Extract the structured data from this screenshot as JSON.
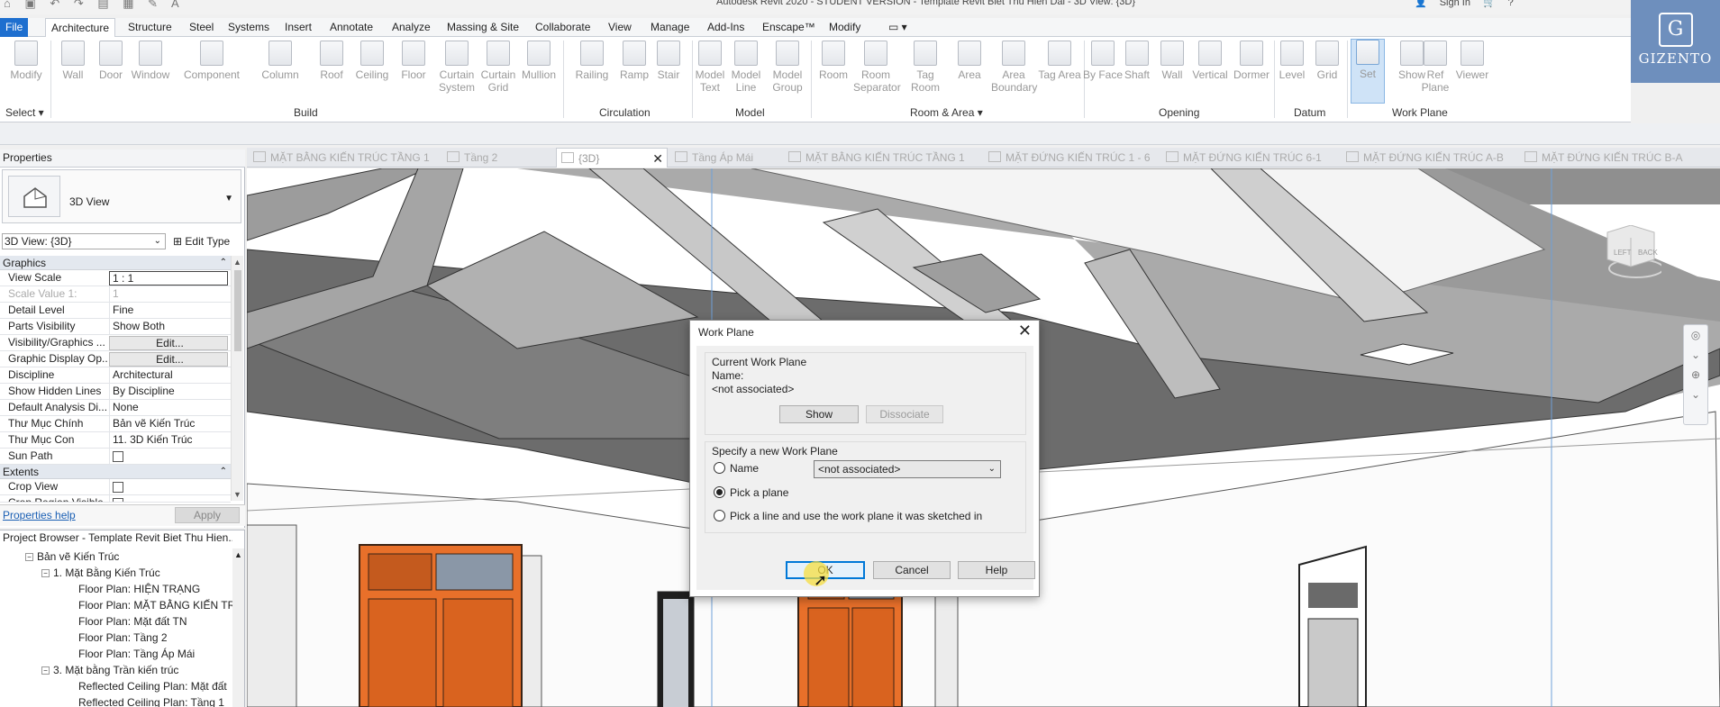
{
  "titlebar": {
    "qat_icons": "⌂ ▣ ↶ ↷ ▤ ▦ ✎ A",
    "title": "Autodesk Revit 2020 - STUDENT VERSION - Template Revit Biet Thu Hien Dai - 3D View: {3D}",
    "sign_in": "Sign In",
    "help": "?"
  },
  "ribbon_tabs": [
    {
      "label": "File"
    },
    {
      "label": "Architecture"
    },
    {
      "label": "Structure"
    },
    {
      "label": "Steel"
    },
    {
      "label": "Systems"
    },
    {
      "label": "Insert"
    },
    {
      "label": "Annotate"
    },
    {
      "label": "Analyze"
    },
    {
      "label": "Massing & Site"
    },
    {
      "label": "Collaborate"
    },
    {
      "label": "View"
    },
    {
      "label": "Manage"
    },
    {
      "label": "Add-Ins"
    },
    {
      "label": "Enscape™"
    },
    {
      "label": "Modify"
    }
  ],
  "ribbon": {
    "buttons": {
      "modify": "Modify",
      "wall": "Wall",
      "door": "Door",
      "window": "Window",
      "component": "Component",
      "column": "Column",
      "roof": "Roof",
      "ceiling": "Ceiling",
      "floor": "Floor",
      "curtain_system": "Curtain System",
      "curtain_grid": "Curtain Grid",
      "mullion": "Mullion",
      "railing": "Railing",
      "ramp": "Ramp",
      "stair": "Stair",
      "model_text": "Model Text",
      "model_line": "Model Line",
      "model_group": "Model Group",
      "room": "Room",
      "room_separator": "Room Separator",
      "tag_room": "Tag Room",
      "area": "Area",
      "area_boundary": "Area Boundary",
      "tag_area": "Tag Area",
      "by_face": "By Face",
      "shaft": "Shaft",
      "wall_open": "Wall",
      "vertical": "Vertical",
      "dormer": "Dormer",
      "level": "Level",
      "grid": "Grid",
      "set": "Set",
      "show": "Show",
      "ref_plane": "Ref Plane",
      "viewer": "Viewer"
    },
    "panels": {
      "select": "Select ▾",
      "build": "Build",
      "circulation": "Circulation",
      "model": "Model",
      "room_area": "Room & Area ▾",
      "opening": "Opening",
      "datum": "Datum",
      "work_plane": "Work Plane"
    }
  },
  "logo": {
    "mark": "G",
    "word": "GIZENTO"
  },
  "properties": {
    "title": "Properties",
    "type_name": "3D View",
    "instance_selector": "3D View: {3D}",
    "edit_type": "Edit Type",
    "categories": {
      "graphics": "Graphics",
      "extents": "Extents"
    },
    "rows": [
      {
        "name": "View Scale",
        "value": "1 : 1"
      },
      {
        "name": "Scale Value    1:",
        "value": "1"
      },
      {
        "name": "Detail Level",
        "value": "Fine"
      },
      {
        "name": "Parts Visibility",
        "value": "Show Both"
      },
      {
        "name": "Visibility/Graphics ...",
        "value": "Edit..."
      },
      {
        "name": "Graphic Display Op...",
        "value": "Edit..."
      },
      {
        "name": "Discipline",
        "value": "Architectural"
      },
      {
        "name": "Show Hidden Lines",
        "value": "By Discipline"
      },
      {
        "name": "Default Analysis Di...",
        "value": "None"
      },
      {
        "name": "Thư Mục Chính",
        "value": "Bản vẽ Kiến Trúc"
      },
      {
        "name": "Thư Mục Con",
        "value": "11. 3D Kiến Trúc"
      },
      {
        "name": "Sun Path",
        "value": ""
      }
    ],
    "extents_rows": [
      {
        "name": "Crop View",
        "value": ""
      },
      {
        "name": "Crop Region Visible",
        "value": ""
      }
    ],
    "help_link": "Properties help",
    "apply": "Apply"
  },
  "browser": {
    "title": "Project Browser - Template Revit Biet Thu Hien...",
    "nodes": [
      {
        "label": "Bản vẽ Kiến Trúc"
      },
      {
        "label": "1. Mặt Bằng Kiến Trúc"
      },
      {
        "label": "Floor Plan: HIỆN TRẠNG"
      },
      {
        "label": "Floor Plan: MẶT BẰNG KIẾN TRÚC"
      },
      {
        "label": "Floor Plan: Mặt đất TN"
      },
      {
        "label": "Floor Plan: Tầng 2"
      },
      {
        "label": "Floor Plan: Tầng Áp Mái"
      },
      {
        "label": "3. Mặt bằng Trần kiến trúc"
      },
      {
        "label": "Reflected Ceiling Plan: Mặt đất"
      },
      {
        "label": "Reflected Ceiling Plan: Tầng 1"
      }
    ]
  },
  "view_tabs": [
    {
      "label": "MẶT BẰNG KIẾN TRÚC TẦNG 1"
    },
    {
      "label": "Tầng 2"
    },
    {
      "label": "{3D}"
    },
    {
      "label": "Tầng Áp Mái"
    },
    {
      "label": "MẶT BẰNG KIẾN TRÚC TẦNG 1"
    },
    {
      "label": "MẶT ĐỨNG KIẾN TRÚC 1 - 6"
    },
    {
      "label": "MẶT ĐỨNG KIẾN TRÚC 6-1"
    },
    {
      "label": "MẶT ĐỨNG KIẾN TRÚC A-B"
    },
    {
      "label": "MẶT ĐỨNG KIẾN TRÚC B-A"
    }
  ],
  "viewcube": {
    "left": "LEFT",
    "back": "BACK"
  },
  "dialog": {
    "title": "Work Plane",
    "current_label": "Current Work Plane",
    "name_label": "Name:",
    "current_value": "<not associated>",
    "show": "Show",
    "dissociate": "Dissociate",
    "specify_label": "Specify a new Work Plane",
    "opt_name": "Name",
    "opt_pick_plane": "Pick a plane",
    "opt_pick_line": "Pick a line and use the work plane it was sketched in",
    "combo_value": "<not associated>",
    "ok": "OK",
    "cancel": "Cancel",
    "help": "Help"
  },
  "colors": {
    "accent": "#1e6fcf",
    "door": "#e8702a",
    "roof": "#8a8a8a"
  }
}
